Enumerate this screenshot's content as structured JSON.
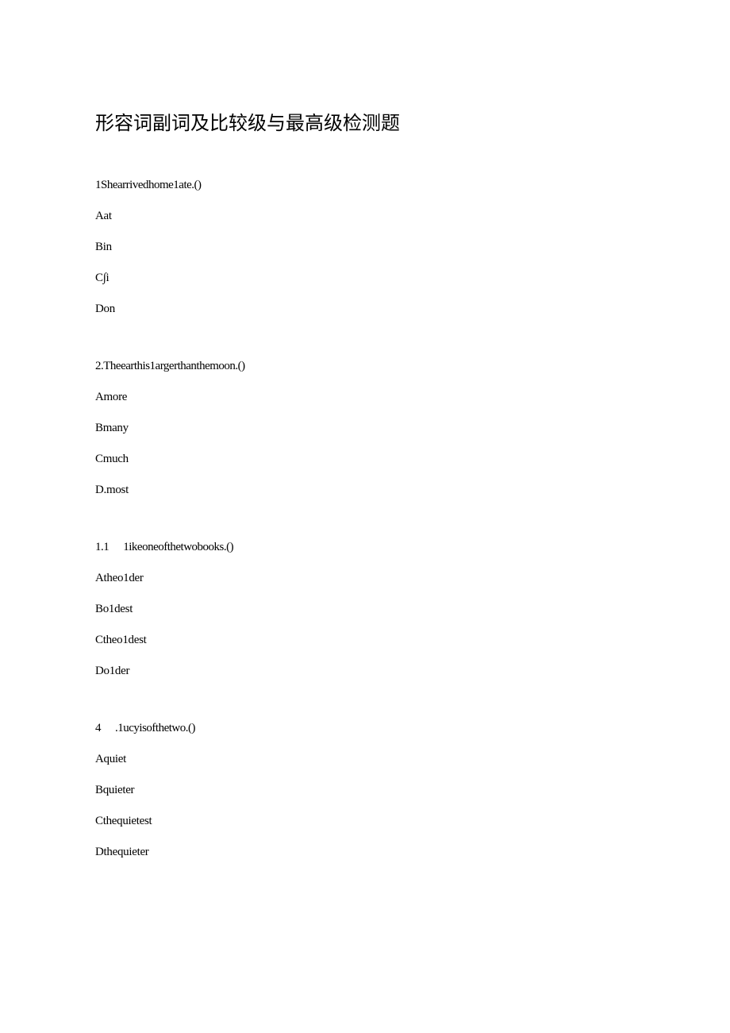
{
  "title": "形容词副词及比较级与最高级检测题",
  "questions": [
    {
      "text": "1Shearrivedhome1ate.()",
      "options": [
        "Aat",
        "Bin",
        "C∫i",
        "Don"
      ]
    },
    {
      "text": "2.Theearthis1argerthanthemoon.()",
      "options": [
        "Amore",
        "Bmany",
        "Cmuch",
        "D.most"
      ]
    },
    {
      "num": "1.1",
      "text": "1ikeoneofthetwobooks.()",
      "options": [
        "Atheo1der",
        "Bo1dest",
        "Ctheo1dest",
        "Do1der"
      ]
    },
    {
      "num": "4",
      "text": ".1ucyisofthetwo.()",
      "options": [
        "Aquiet",
        "Bquieter",
        "Cthequietest",
        "Dthequieter"
      ]
    }
  ]
}
